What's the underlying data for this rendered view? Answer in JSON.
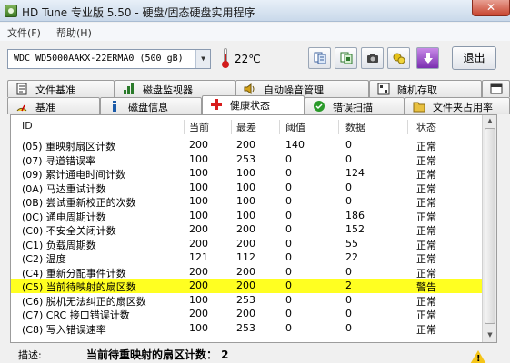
{
  "window": {
    "title": "HD Tune 专业版 5.50 - 硬盘/固态硬盘实用程序",
    "close_label": "✕"
  },
  "menu": [
    {
      "label": "文件(F)"
    },
    {
      "label": "帮助(H)"
    }
  ],
  "toolbar": {
    "drive": "WDC WD5000AAKX-22ERMA0 (500 gB)",
    "temperature": "22℃",
    "exit_label": "退出",
    "icons": [
      "copy-info-icon",
      "copy-screen-icon",
      "camera-icon",
      "options-icon",
      "download-icon"
    ]
  },
  "tabs_row1": [
    {
      "label": "文件基准",
      "icon": "file-benchmark-icon"
    },
    {
      "label": "磁盘监视器",
      "icon": "disk-monitor-icon"
    },
    {
      "label": "自动噪音管理",
      "icon": "speaker-icon"
    },
    {
      "label": "随机存取",
      "icon": "random-access-icon"
    },
    {
      "label": "",
      "icon": "extra-tab-icon"
    }
  ],
  "tabs_row2": [
    {
      "label": "基准",
      "icon": "benchmark-icon"
    },
    {
      "label": "磁盘信息",
      "icon": "info-icon"
    },
    {
      "label": "健康状态",
      "icon": "health-cross-icon"
    },
    {
      "label": "错误扫描",
      "icon": "error-scan-icon"
    },
    {
      "label": "文件夹占用率",
      "icon": "folder-icon"
    }
  ],
  "table": {
    "headers": [
      "ID",
      "当前",
      "最差",
      "阈值",
      "数据",
      "状态"
    ],
    "rows": [
      [
        "(05) 重映射扇区计数",
        "200",
        "200",
        "140",
        "0",
        "正常"
      ],
      [
        "(07) 寻道错误率",
        "100",
        "253",
        "0",
        "0",
        "正常"
      ],
      [
        "(09) 累计通电时间计数",
        "100",
        "100",
        "0",
        "124",
        "正常"
      ],
      [
        "(0A) 马达重试计数",
        "100",
        "100",
        "0",
        "0",
        "正常"
      ],
      [
        "(0B) 尝试重新校正的次数",
        "100",
        "100",
        "0",
        "0",
        "正常"
      ],
      [
        "(0C) 通电周期计数",
        "100",
        "100",
        "0",
        "186",
        "正常"
      ],
      [
        "(C0) 不安全关闭计数",
        "200",
        "200",
        "0",
        "152",
        "正常"
      ],
      [
        "(C1) 负载周期数",
        "200",
        "200",
        "0",
        "55",
        "正常"
      ],
      [
        "(C2) 温度",
        "121",
        "112",
        "0",
        "22",
        "正常"
      ],
      [
        "(C4) 重新分配事件计数",
        "200",
        "200",
        "0",
        "0",
        "正常"
      ],
      [
        "(C5) 当前待映射的扇区数",
        "200",
        "200",
        "0",
        "2",
        "警告"
      ],
      [
        "(C6) 脱机无法纠正的扇区数",
        "100",
        "253",
        "0",
        "0",
        "正常"
      ],
      [
        "(C7) CRC 接口错误计数",
        "200",
        "200",
        "0",
        "0",
        "正常"
      ],
      [
        "(C8) 写入错误速率",
        "100",
        "253",
        "0",
        "0",
        "正常"
      ]
    ],
    "warning_row_index": 10,
    "warning_color": "#ffff21"
  },
  "description": {
    "label": "描述:",
    "value": "当前待重映射的扇区计数： 2"
  }
}
